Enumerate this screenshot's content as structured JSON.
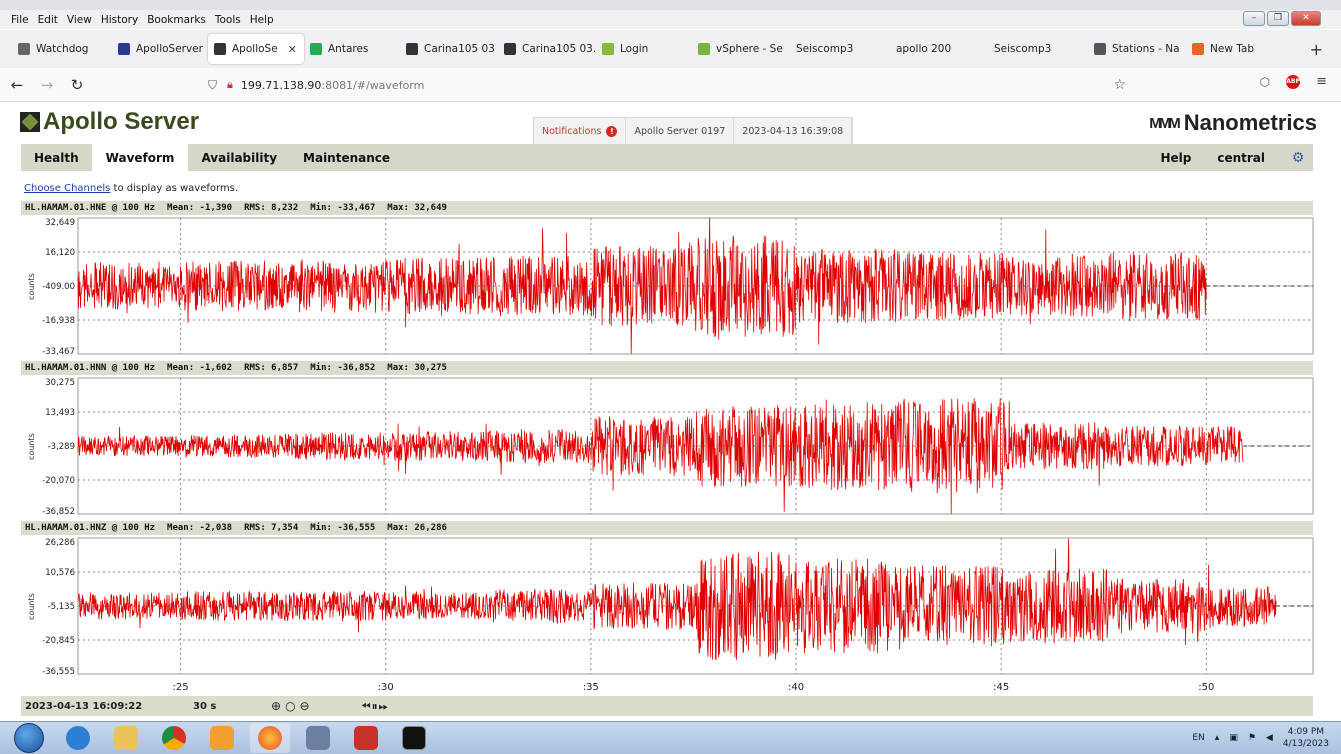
{
  "menubar": {
    "items": [
      "File",
      "Edit",
      "View",
      "History",
      "Bookmarks",
      "Tools",
      "Help"
    ]
  },
  "tabs": [
    {
      "label": "Watchdog",
      "color": "#666"
    },
    {
      "label": "ApolloServer",
      "color": "#2a3b8f"
    },
    {
      "label": "ApolloSe",
      "color": "#333",
      "active": true
    },
    {
      "label": "Antares",
      "color": "#2a5"
    },
    {
      "label": "Carina105 03",
      "color": "#333"
    },
    {
      "label": "Carina105 03.",
      "color": "#333"
    },
    {
      "label": "Login",
      "color": "#8bb93a"
    },
    {
      "label": "vSphere - Se",
      "color": "#7bb43a"
    },
    {
      "label": "Seiscomp3",
      "color": ""
    },
    {
      "label": "apollo 200",
      "color": ""
    },
    {
      "label": "Seiscomp3",
      "color": ""
    },
    {
      "label": "Stations - Na",
      "color": "#555"
    },
    {
      "label": "New Tab",
      "color": "#e8642b"
    }
  ],
  "url": {
    "host": "199.71.138.90",
    "rest": ":8081/#/waveform"
  },
  "header": {
    "title": "Apollo Server",
    "notifications_label": "Notifications",
    "notif_badge": "!",
    "server_name": "Apollo Server 0197",
    "datetime": "2023-04-13 16:39:08",
    "brand": "Nanometrics",
    "brand_mark": "MMM"
  },
  "appnav": {
    "left": [
      "Health",
      "Waveform",
      "Availability",
      "Maintenance"
    ],
    "active": "Waveform",
    "help": "Help",
    "user": "central"
  },
  "hint": {
    "link": "Choose Channels",
    "text": " to display as waveforms."
  },
  "channels": [
    {
      "header": "HL.HAMAM.01.HNE @ 100 Hz",
      "mean": "Mean: -1,390",
      "rms": "RMS: 8,232",
      "min": "Min: -33,467",
      "max": "Max: 32,649",
      "ticks": [
        "32,649",
        "16,120",
        "-409.00",
        "-16,938",
        "-33,467"
      ],
      "ymin": -33467,
      "ymax": 32649,
      "mean_level": -409,
      "ylabel": "counts",
      "trace_end": 50.0,
      "envelope": [
        0.35,
        0.38,
        0.4,
        0.42,
        0.45,
        0.6,
        0.75,
        0.55,
        0.5,
        0.45,
        0.5,
        0.48
      ]
    },
    {
      "header": "HL.HAMAM.01.HNN @ 100 Hz",
      "mean": "Mean: -1,602",
      "rms": "RMS: 6,857",
      "min": "Min: -36,852",
      "max": "Max: 30,275",
      "ticks": [
        "30,275",
        "13,493",
        "-3,289",
        "-20,070",
        "-36,852"
      ],
      "ymin": -36852,
      "ymax": 30275,
      "mean_level": -3289,
      "ylabel": "counts",
      "trace_end": 50.9,
      "envelope": [
        0.15,
        0.17,
        0.2,
        0.22,
        0.25,
        0.45,
        0.6,
        0.65,
        0.7,
        0.35,
        0.3,
        0.3
      ]
    },
    {
      "header": "HL.HAMAM.01.HNZ @ 100 Hz",
      "mean": "Mean: -2,038",
      "rms": "RMS: 7,354",
      "min": "Min: -36,555",
      "max": "Max: 26,286",
      "ticks": [
        "26,286",
        "10,576",
        "-5,135",
        "-20,845",
        "-36,555"
      ],
      "ymin": -36555,
      "ymax": 26286,
      "mean_level": -5135,
      "ylabel": "counts",
      "trace_end": 51.7,
      "envelope": [
        0.2,
        0.22,
        0.22,
        0.2,
        0.25,
        0.35,
        0.8,
        0.7,
        0.6,
        0.55,
        0.4,
        0.3
      ]
    }
  ],
  "xaxis": {
    "start": 22.5,
    "end": 52.6,
    "ticks": [
      25,
      30,
      35,
      40,
      45,
      50
    ],
    "tick_labels": [
      ":25",
      ":30",
      ":35",
      ":40",
      ":45",
      ":50"
    ]
  },
  "bottom": {
    "timestamp": "2023-04-13 16:09:22",
    "window": "30 s"
  },
  "taskbar": {
    "lang": "EN",
    "time": "4:09 PM",
    "date": "4/13/2023"
  },
  "colors": {
    "trace": "#e00000",
    "nav_bg": "#d5d8c8",
    "header_bg": "#dcdccc"
  }
}
